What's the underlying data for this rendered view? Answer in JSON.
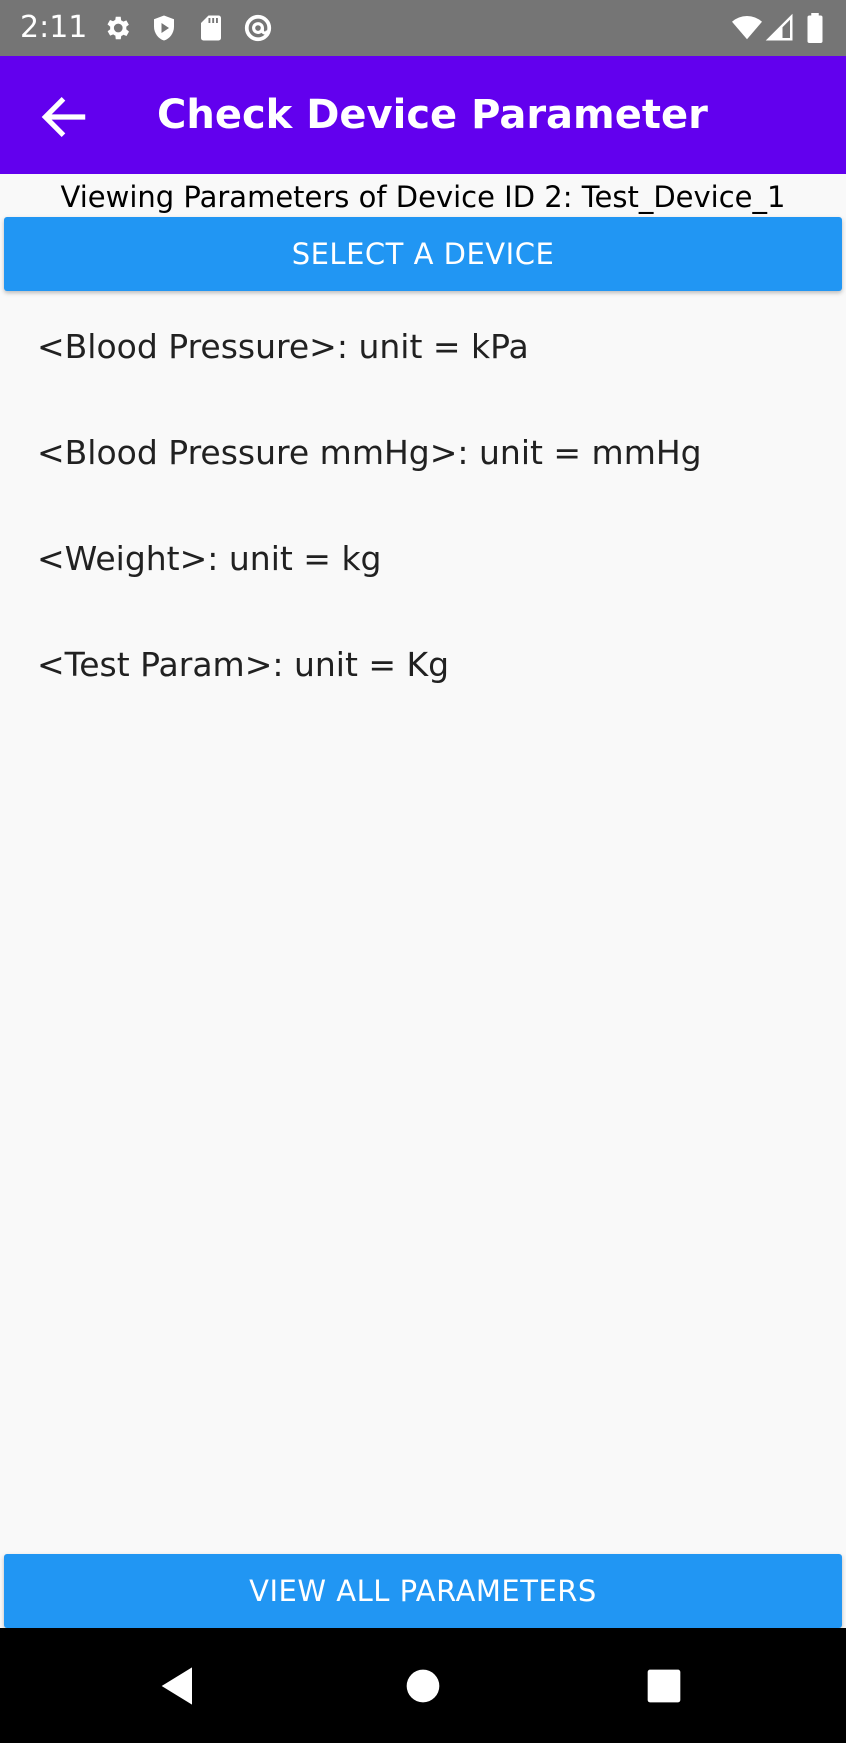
{
  "status_bar": {
    "time": "2:11",
    "left_icons": [
      "gear-icon",
      "shield-play-icon",
      "sd-card-icon",
      "at-sign-icon"
    ],
    "right_icons": [
      "wifi-icon",
      "signal-icon",
      "battery-icon"
    ]
  },
  "app_bar": {
    "title": "Check Device Parameter",
    "back_icon": "arrow-back-icon",
    "color": "#6200ee"
  },
  "viewing_label": "Viewing Parameters of Device ID 2: Test_Device_1",
  "select_button_label": "SELECT A DEVICE",
  "parameters": [
    {
      "text": "<Blood Pressure>: unit = kPa"
    },
    {
      "text": "<Blood Pressure mmHg>: unit = mmHg"
    },
    {
      "text": "<Weight>: unit = kg"
    },
    {
      "text": "<Test Param>: unit = Kg"
    }
  ],
  "view_all_button_label": "VIEW ALL PARAMETERS",
  "button_color": "#2196f3",
  "nav_bar": {
    "buttons": [
      "back-triangle-icon",
      "home-circle-icon",
      "recents-square-icon"
    ]
  }
}
